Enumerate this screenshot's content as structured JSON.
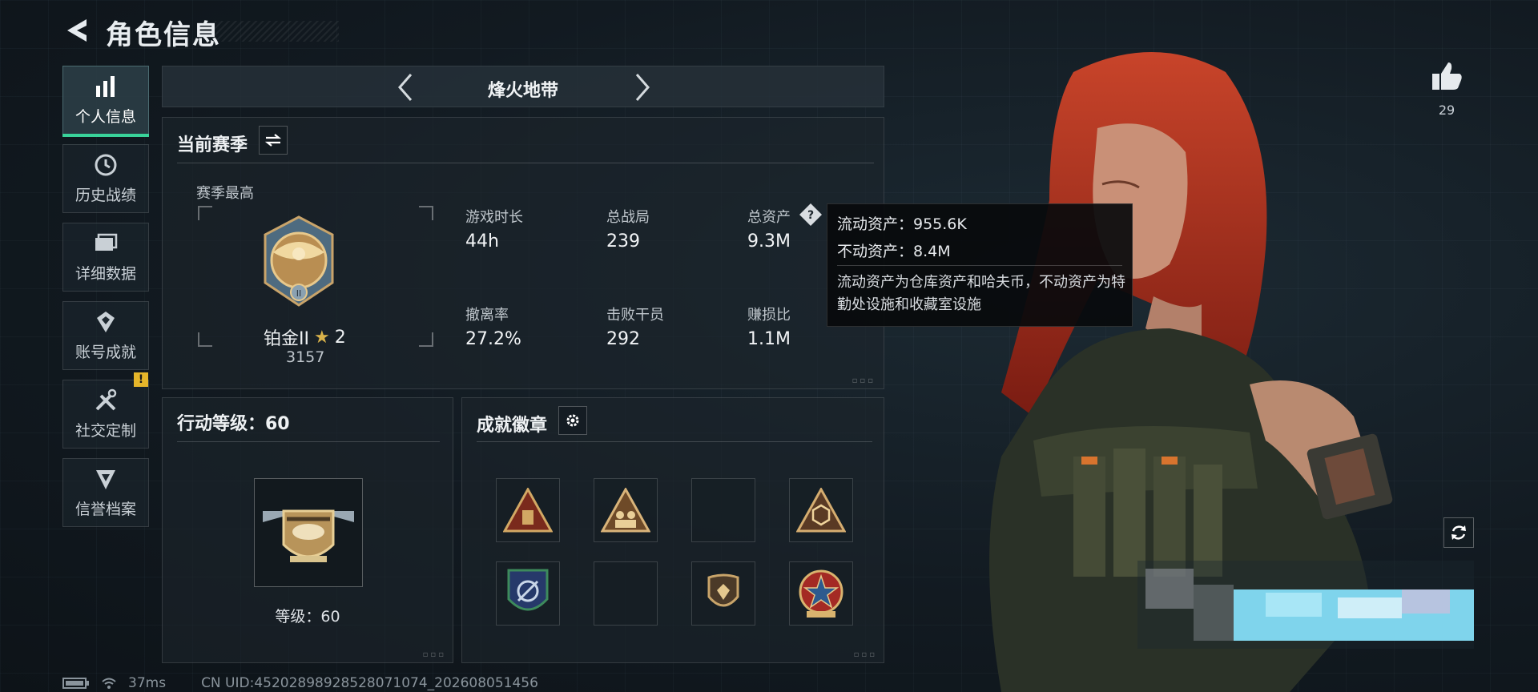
{
  "header": {
    "title": "角色信息"
  },
  "sidebar": {
    "items": [
      {
        "label": "个人信息",
        "icon": "bar-chart-icon",
        "active": true
      },
      {
        "label": "历史战绩",
        "icon": "clock-history-icon"
      },
      {
        "label": "详细数据",
        "icon": "folder-icon"
      },
      {
        "label": "账号成就",
        "icon": "achievement-icon"
      },
      {
        "label": "社交定制",
        "icon": "tools-icon",
        "badge": "!"
      },
      {
        "label": "信誉档案",
        "icon": "reputation-icon"
      }
    ]
  },
  "mode_selector": {
    "name": "烽火地带"
  },
  "season_panel": {
    "title": "当前赛季",
    "season_best_label": "赛季最高",
    "rank_name": "铂金II",
    "rank_stars": "2",
    "rank_score": "3157",
    "stats": [
      {
        "label": "游戏时长",
        "value": "44h"
      },
      {
        "label": "总战局",
        "value": "239"
      },
      {
        "label": "总资产",
        "value": "9.3M"
      },
      {
        "label": "撤离率",
        "value": "27.2%"
      },
      {
        "label": "击败干员",
        "value": "292"
      },
      {
        "label": "赚损比",
        "value": "1.1M"
      }
    ]
  },
  "tooltip": {
    "liquid": "流动资产：955.6K",
    "fixed": "不动资产：8.4M",
    "description": "流动资产为仓库资产和哈夫币，不动资产为特勤处设施和收藏室设施"
  },
  "level_panel": {
    "title": "行动等级：60",
    "level_text": "等级：60"
  },
  "badges_panel": {
    "title": "成就徽章",
    "badges": [
      "triangle-crate-badge",
      "triangle-soldiers-badge",
      "empty",
      "triangle-hex-badge",
      "shield-blue-badge",
      "empty",
      "shield-bronze-badge",
      "star-medal-badge"
    ]
  },
  "likes": {
    "count": "29"
  },
  "footer": {
    "ping": "37ms",
    "uid": "CN UID:452028989285280710​74_202608051456"
  },
  "colors": {
    "accent": "#39d39a",
    "warning": "#e5b52a",
    "hair": "#b0321e"
  }
}
